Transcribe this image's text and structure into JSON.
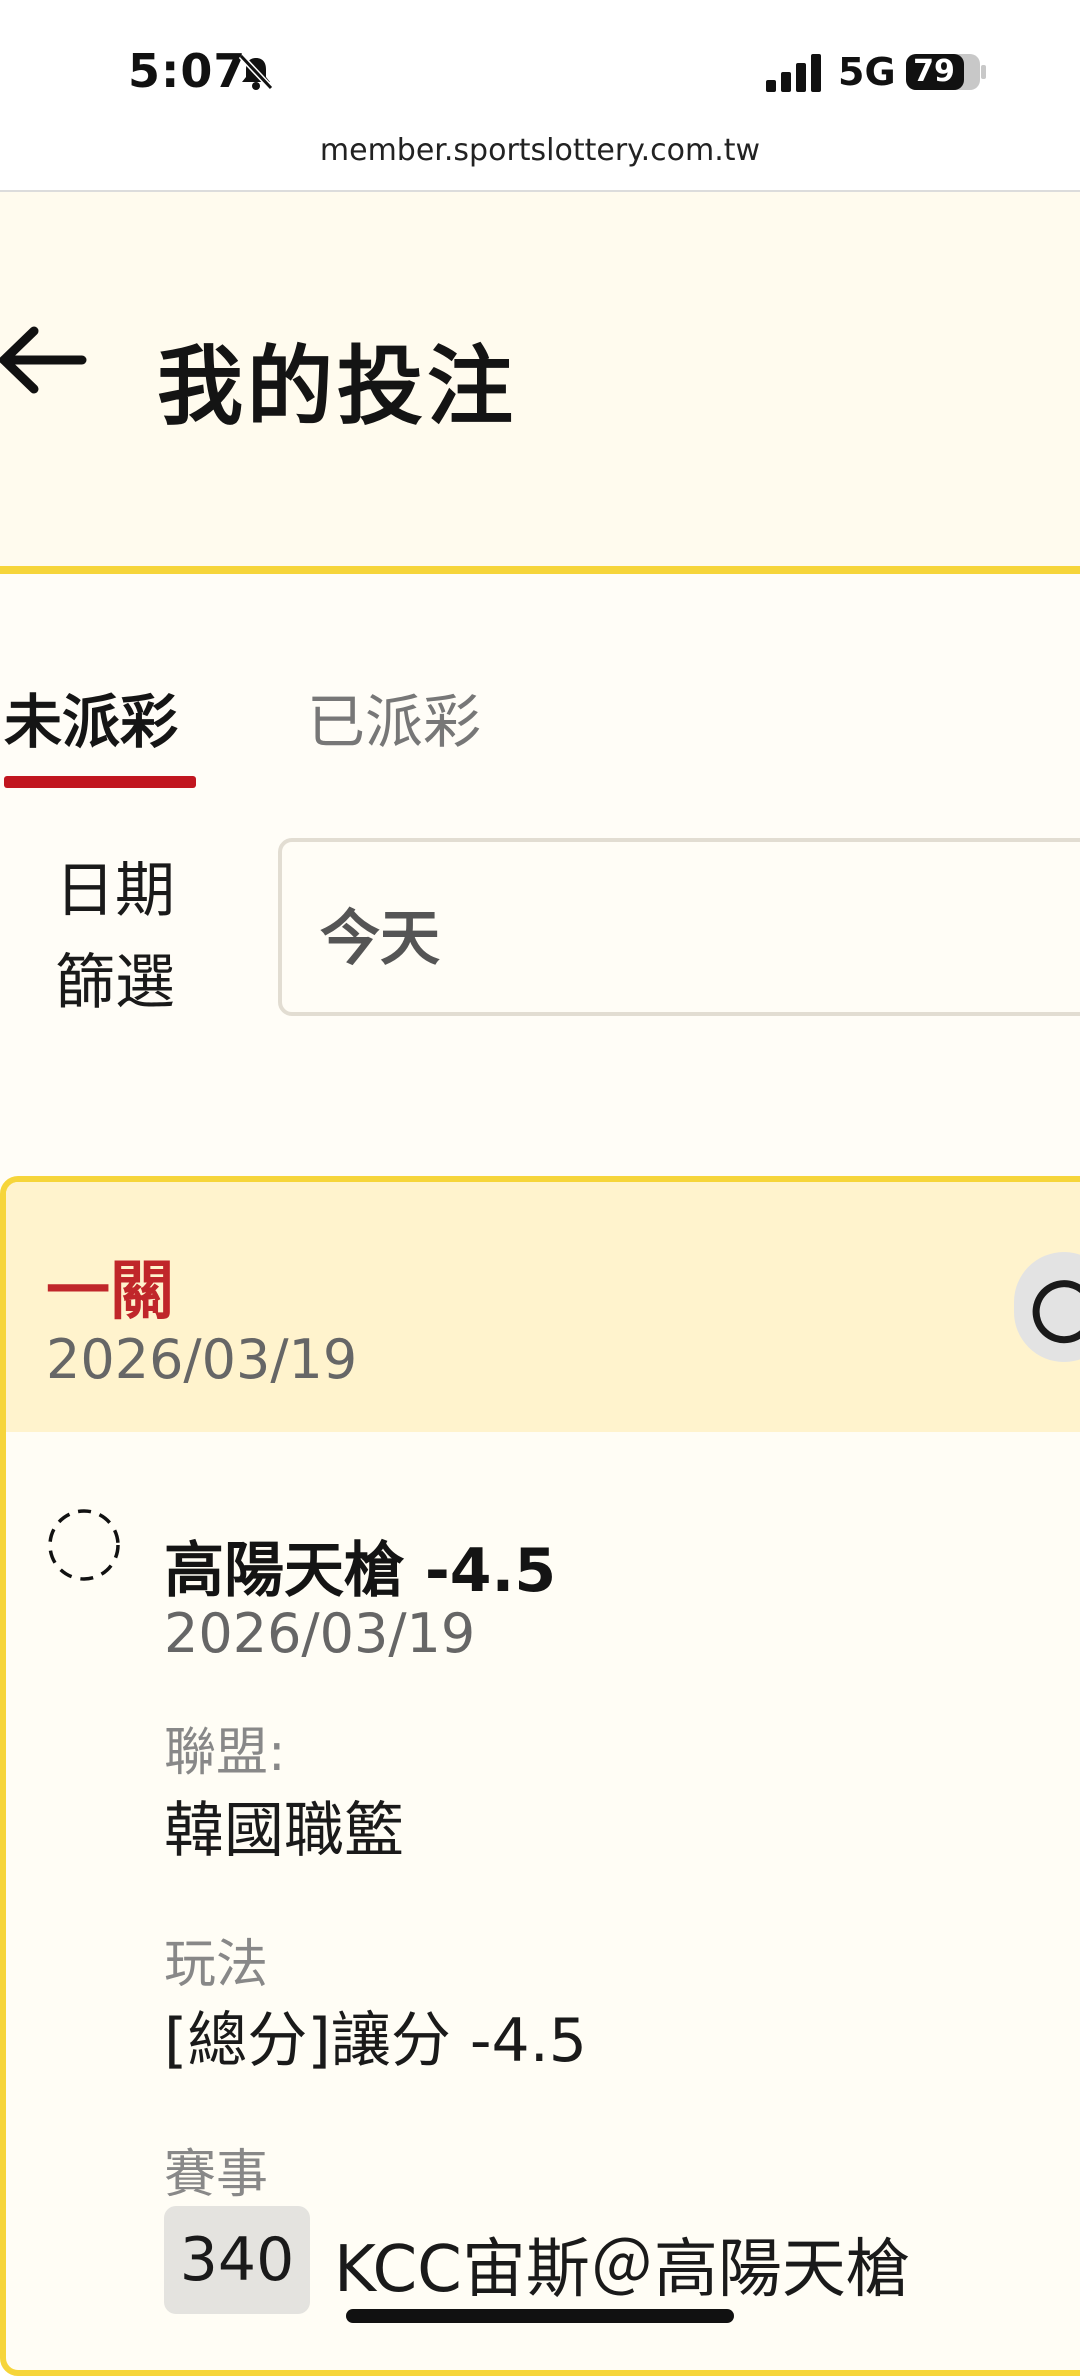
{
  "status_bar": {
    "time": "5:07",
    "network": "5G",
    "battery": "79"
  },
  "browser": {
    "url": "member.sportslottery.com.tw"
  },
  "header": {
    "title": "我的投注"
  },
  "tabs": [
    {
      "label": "未派彩",
      "active": true
    },
    {
      "label": "已派彩",
      "active": false
    }
  ],
  "filter": {
    "label_line1": "日期",
    "label_line2": "篩選",
    "value": "今天"
  },
  "bet_card": {
    "type": "一關",
    "date": "2026/03/19",
    "selection": {
      "title": "高陽天槍 -4.5",
      "date": "2026/03/19",
      "league_label": "聯盟:",
      "league_value": "韓國職籃",
      "play_label": "玩法",
      "play_value": "[總分]讓分 -4.5",
      "event_label": "賽事",
      "event_number": "340",
      "event_name": "KCC宙斯＠高陽天槍"
    }
  },
  "colors": {
    "accent_yellow": "#f6d53a",
    "active_red": "#c1161f",
    "header_bg": "#fffbee",
    "card_head_bg": "#fff3cd"
  },
  "icons": [
    "bell-slash-icon",
    "signal-icon",
    "battery-icon",
    "back-arrow-icon",
    "pending-status-icon",
    "refresh-icon"
  ]
}
